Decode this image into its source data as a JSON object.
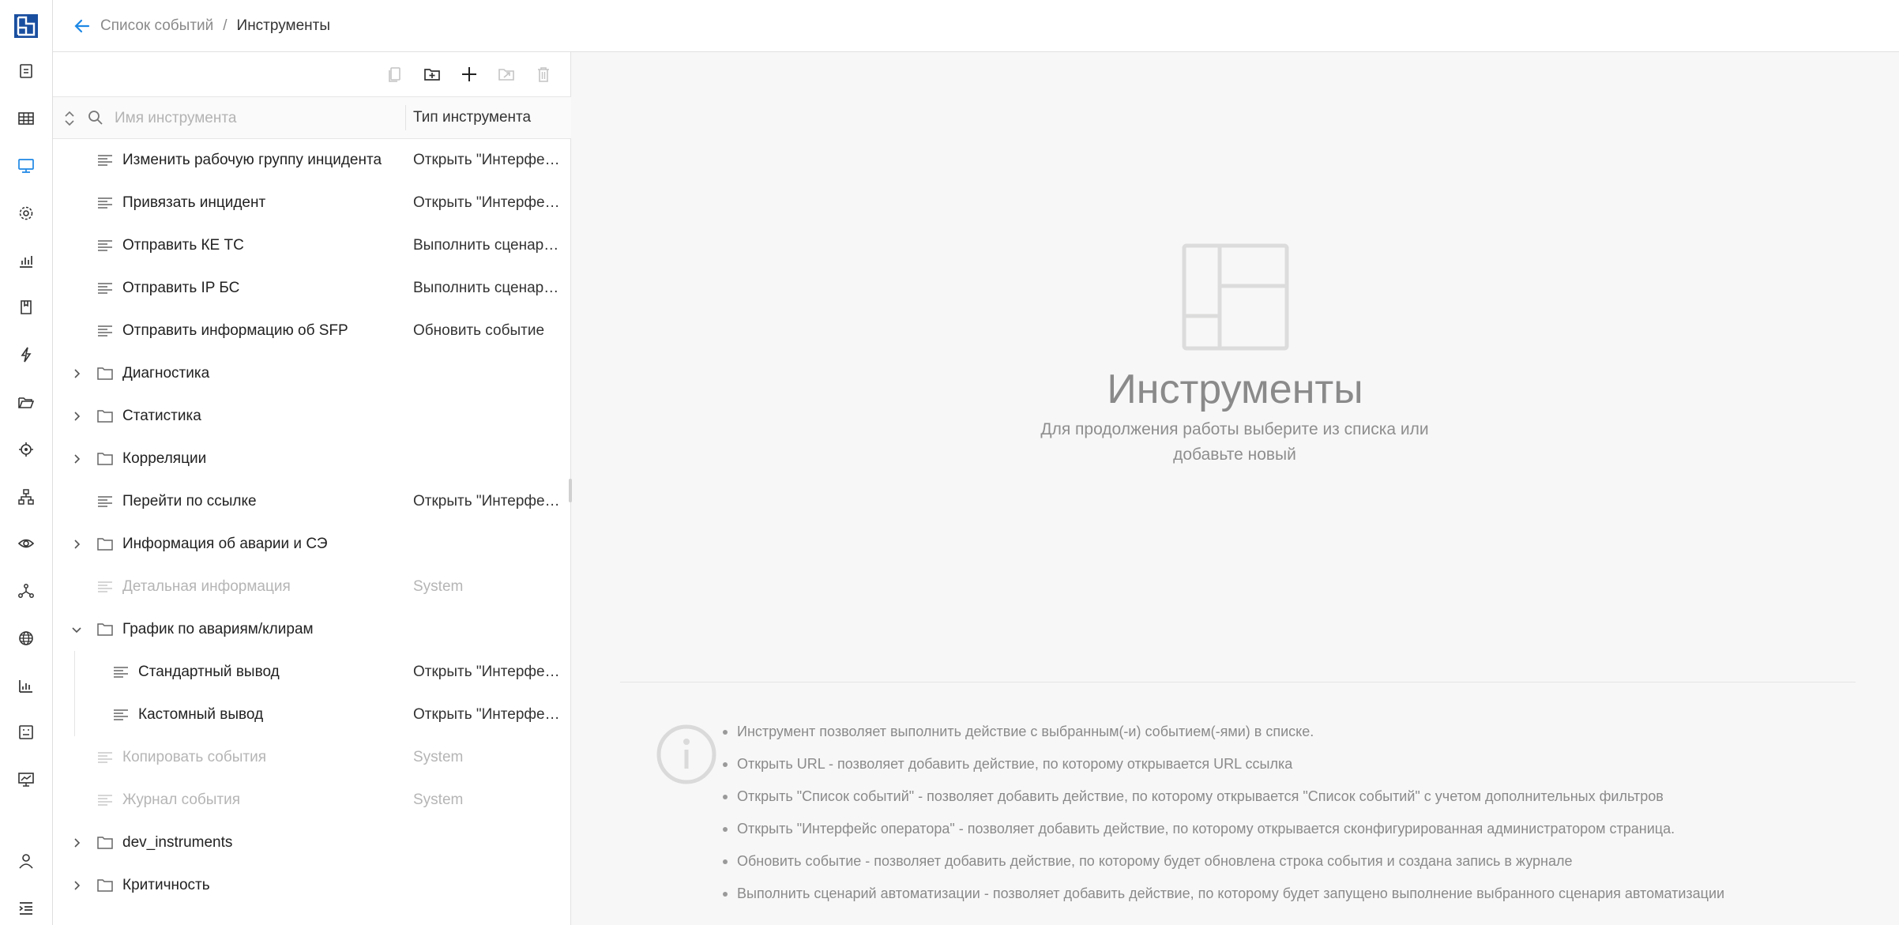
{
  "header": {
    "back_link": "Список событий",
    "separator": "/",
    "current": "Инструменты"
  },
  "rail": {
    "items": [
      "logo-icon",
      "reports-icon",
      "table-icon",
      "monitor-icon",
      "gear-icon",
      "chart-icon",
      "book-icon",
      "lightning-icon",
      "folder-open-icon",
      "target-icon",
      "hierarchy-icon",
      "eye-icon",
      "network-icon",
      "globe-icon",
      "bar-chart-icon",
      "dashboard-icon",
      "presentation-icon",
      "user-icon",
      "menu-indent-icon"
    ],
    "active": "monitor-icon",
    "accent": "#1e88e5"
  },
  "toolbar": {
    "buttons": [
      "copy-icon",
      "add-folder-icon",
      "plus-icon",
      "move-icon",
      "trash-icon"
    ]
  },
  "list": {
    "search_placeholder": "Имя инструмента",
    "column_type": "Тип инструмента",
    "rows": [
      {
        "name": "Изменить рабочую группу инцидента",
        "type": "Открыть \"Интерфейс оператора\"",
        "kind": "tool",
        "level": 0,
        "disabled": false
      },
      {
        "name": "Привязать инцидент",
        "type": "Открыть \"Интерфейс оператора\"",
        "kind": "tool",
        "level": 0,
        "disabled": false
      },
      {
        "name": "Отправить КЕ ТС",
        "type": "Выполнить сценарий автоматизации",
        "kind": "tool",
        "level": 0,
        "disabled": false
      },
      {
        "name": "Отправить IP БС",
        "type": "Выполнить сценарий автоматизации",
        "kind": "tool",
        "level": 0,
        "disabled": false
      },
      {
        "name": "Отправить информацию об SFP",
        "type": "Обновить событие",
        "kind": "tool",
        "level": 0,
        "disabled": false
      },
      {
        "name": "Диагностика",
        "type": "",
        "kind": "folder",
        "level": 0,
        "expanded": false,
        "disabled": false
      },
      {
        "name": "Статистика",
        "type": "",
        "kind": "folder",
        "level": 0,
        "expanded": false,
        "disabled": false
      },
      {
        "name": "Корреляции",
        "type": "",
        "kind": "folder",
        "level": 0,
        "expanded": false,
        "disabled": false
      },
      {
        "name": "Перейти по ссылке",
        "type": "Открыть \"Интерфейс оператора\"",
        "kind": "tool",
        "level": 0,
        "disabled": false
      },
      {
        "name": "Информация об аварии и СЭ",
        "type": "",
        "kind": "folder",
        "level": 0,
        "expanded": false,
        "disabled": false
      },
      {
        "name": "Детальная информация",
        "type": "System",
        "kind": "tool",
        "level": 0,
        "disabled": true
      },
      {
        "name": "График по авариям/клирам",
        "type": "",
        "kind": "folder",
        "level": 0,
        "expanded": true,
        "disabled": false
      },
      {
        "name": "Стандартный вывод",
        "type": "Открыть \"Интерфейс оператора\"",
        "kind": "tool",
        "level": 1,
        "disabled": false
      },
      {
        "name": "Кастомный вывод",
        "type": "Открыть \"Интерфейс оператора\"",
        "kind": "tool",
        "level": 1,
        "disabled": false
      },
      {
        "name": "Копировать события",
        "type": "System",
        "kind": "tool",
        "level": 0,
        "disabled": true
      },
      {
        "name": "Журнал события",
        "type": "System",
        "kind": "tool",
        "level": 0,
        "disabled": true
      },
      {
        "name": "dev_instruments",
        "type": "",
        "kind": "folder",
        "level": 0,
        "expanded": false,
        "disabled": false
      },
      {
        "name": "Критичность",
        "type": "",
        "kind": "folder",
        "level": 0,
        "expanded": false,
        "disabled": false
      }
    ]
  },
  "empty_state": {
    "title": "Инструменты",
    "subtitle": "Для продолжения работы выберите из списка или добавьте новый"
  },
  "info": {
    "items": [
      "Инструмент позволяет выполнить действие с выбранным(-и) событием(-ями) в списке.",
      "Открыть URL - позволяет добавить действие, по которому открывается URL ссылка",
      "Открыть \"Список событий\" - позволяет добавить действие, по которому открывается \"Список событий\" с учетом дополнительных фильтров",
      "Открыть \"Интерфейс оператора\" - позволяет добавить действие, по которому открывается сконфигурированная администратором страница.",
      "Обновить событие - позволяет добавить действие, по которому будет обновлена строка события и создана запись в журнале",
      "Выполнить сценарий автоматизации - позволяет добавить действие, по которому будет запущено выполнение выбранного сценария автоматизации"
    ]
  }
}
